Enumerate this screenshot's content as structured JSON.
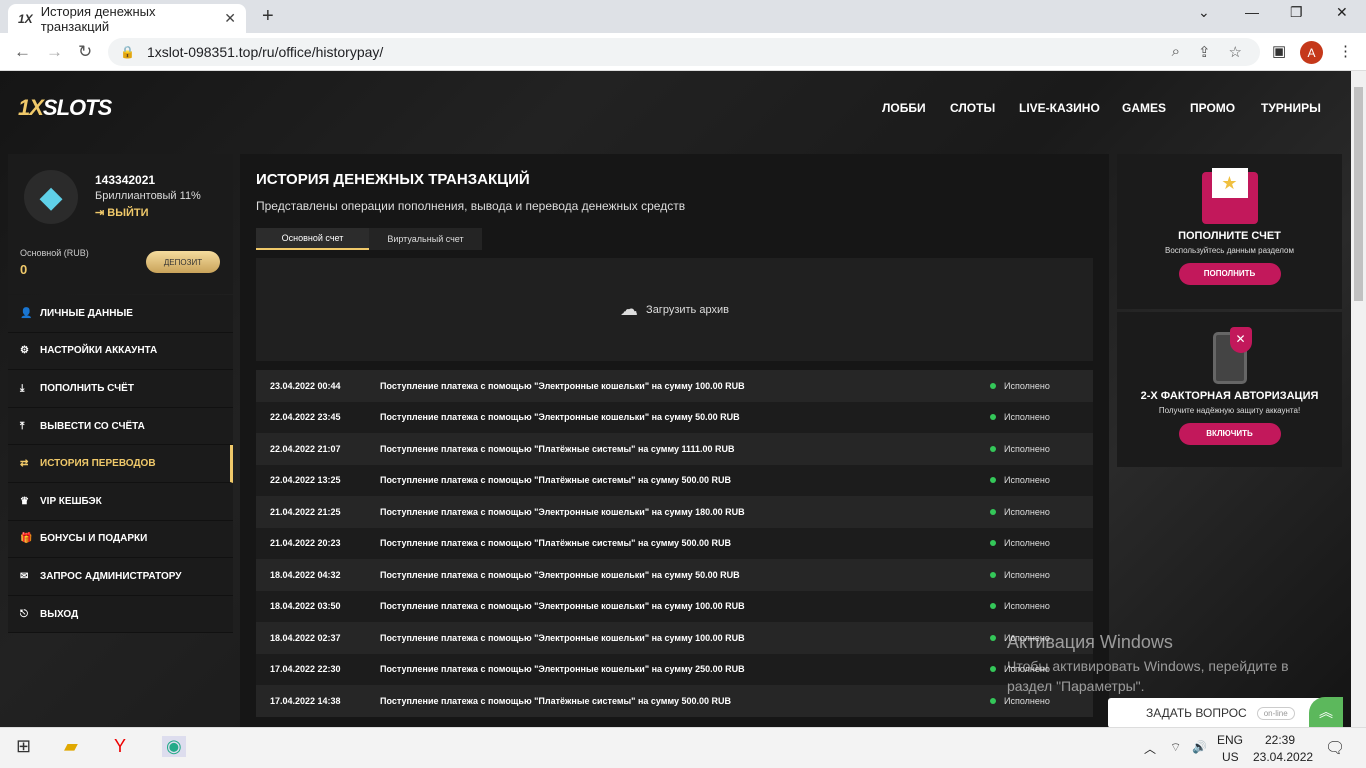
{
  "browser": {
    "tab_favicon": "1X",
    "tab_title": "История денежных транзакций",
    "url": "1xslot-098351.top/ru/office/historypay/",
    "profile_initial": "A"
  },
  "header": {
    "logo_main": "1X",
    "logo_rest": "SLOTS",
    "nav": [
      "ЛОББИ",
      "СЛОТЫ",
      "LIVE-КАЗИНО",
      "GAMES",
      "ПРОМО",
      "ТУРНИРЫ"
    ]
  },
  "user": {
    "id": "143342021",
    "level": "Бриллиантовый 11%",
    "logout": "ВЫЙТИ",
    "balance_label": "Основной (RUB)",
    "balance_value": "0",
    "deposit_button": "ДЕПОЗИТ"
  },
  "menu": [
    {
      "label": "ЛИЧНЫЕ ДАННЫЕ",
      "icon": "user-plus-icon"
    },
    {
      "label": "НАСТРОЙКИ АККАУНТА",
      "icon": "gears-icon"
    },
    {
      "label": "ПОПОЛНИТЬ СЧЁТ",
      "icon": "download-icon"
    },
    {
      "label": "ВЫВЕСТИ СО СЧЁТА",
      "icon": "upload-icon"
    },
    {
      "label": "ИСТОРИЯ ПЕРЕВОДОВ",
      "icon": "transfer-icon"
    },
    {
      "label": "VIP КЕШБЭК",
      "icon": "crown-icon"
    },
    {
      "label": "БОНУСЫ И ПОДАРКИ",
      "icon": "gift-icon"
    },
    {
      "label": "ЗАПРОС АДМИНИСТРАТОРУ",
      "icon": "mail-icon"
    },
    {
      "label": "ВЫХОД",
      "icon": "exit-icon"
    }
  ],
  "main": {
    "title": "ИСТОРИЯ ДЕНЕЖНЫХ ТРАНЗАКЦИЙ",
    "subtitle": "Представлены операции пополнения, вывода и перевода денежных средств",
    "tabs": [
      "Основной счет",
      "Виртуальный счет"
    ],
    "archive_label": "Загрузить архив",
    "transactions": [
      {
        "date": "23.04.2022 00:44",
        "desc": "Поступление платежа с помощью \"Электронные кошельки\" на сумму 100.00 RUB",
        "status": "Исполнено"
      },
      {
        "date": "22.04.2022 23:45",
        "desc": "Поступление платежа с помощью \"Электронные кошельки\" на сумму 50.00 RUB",
        "status": "Исполнено"
      },
      {
        "date": "22.04.2022 21:07",
        "desc": "Поступление платежа с помощью \"Платёжные системы\" на сумму 1111.00 RUB",
        "status": "Исполнено"
      },
      {
        "date": "22.04.2022 13:25",
        "desc": "Поступление платежа с помощью \"Платёжные системы\" на сумму 500.00 RUB",
        "status": "Исполнено"
      },
      {
        "date": "21.04.2022 21:25",
        "desc": "Поступление платежа с помощью \"Электронные кошельки\" на сумму 180.00 RUB",
        "status": "Исполнено"
      },
      {
        "date": "21.04.2022 20:23",
        "desc": "Поступление платежа с помощью \"Платёжные системы\" на сумму 500.00 RUB",
        "status": "Исполнено"
      },
      {
        "date": "18.04.2022 04:32",
        "desc": "Поступление платежа с помощью \"Электронные кошельки\" на сумму 50.00 RUB",
        "status": "Исполнено"
      },
      {
        "date": "18.04.2022 03:50",
        "desc": "Поступление платежа с помощью \"Электронные кошельки\" на сумму 100.00 RUB",
        "status": "Исполнено"
      },
      {
        "date": "18.04.2022 02:37",
        "desc": "Поступление платежа с помощью \"Электронные кошельки\" на сумму 100.00 RUB",
        "status": "Исполнено"
      },
      {
        "date": "17.04.2022 22:30",
        "desc": "Поступление платежа с помощью \"Электронные кошельки\" на сумму 250.00 RUB",
        "status": "Исполнено"
      },
      {
        "date": "17.04.2022 14:38",
        "desc": "Поступление платежа с помощью \"Платёжные системы\" на сумму 500.00 RUB",
        "status": "Исполнено"
      }
    ]
  },
  "right": {
    "deposit_title": "ПОПОЛНИТЕ СЧЕТ",
    "deposit_sub": "Воспользуйтесь данным разделом",
    "deposit_button": "ПОПОЛНИТЬ",
    "twofa_title": "2-Х ФАКТОРНАЯ АВТОРИЗАЦИЯ",
    "twofa_sub": "Получите надёжную защиту аккаунта!",
    "twofa_button": "ВКЛЮЧИТЬ"
  },
  "watermark": {
    "title": "Активация Windows",
    "text": "Чтобы активировать Windows, перейдите в раздел \"Параметры\"."
  },
  "chat": {
    "label": "ЗАДАТЬ ВОПРОС",
    "status": "on-line"
  },
  "taskbar": {
    "lang1": "ENG",
    "lang2": "US",
    "time": "22:39",
    "date": "23.04.2022"
  },
  "colors": {
    "accent": "#f0c96a",
    "pink": "#c2185b",
    "status_ok": "#34c759"
  }
}
